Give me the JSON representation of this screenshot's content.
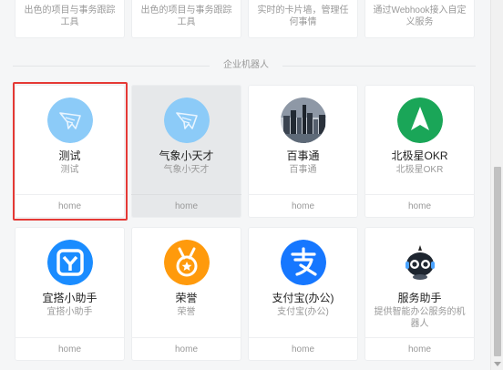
{
  "top_row": [
    {
      "desc": "出色的项目与事务跟踪工具"
    },
    {
      "desc": "出色的项目与事务跟踪工具"
    },
    {
      "desc": "实时的卡片墙，管理任何事情"
    },
    {
      "desc": "通过Webhook接入自定义服务"
    }
  ],
  "section": {
    "label": "企业机器人"
  },
  "robots": [
    {
      "title": "测试",
      "subtitle": "测试",
      "footer": "home",
      "icon": "robot-bird-icon",
      "selected": true,
      "disabled": false
    },
    {
      "title": "气象小天才",
      "subtitle": "气象小天才",
      "footer": "home",
      "icon": "robot-bird-icon",
      "selected": false,
      "disabled": true
    },
    {
      "title": "百事通",
      "subtitle": "百事通",
      "footer": "home",
      "icon": "city-skyline-icon",
      "selected": false,
      "disabled": false
    },
    {
      "title": "北极星OKR",
      "subtitle": "北极星OKR",
      "footer": "home",
      "icon": "north-star-icon",
      "selected": false,
      "disabled": false
    },
    {
      "title": "宜搭小助手",
      "subtitle": "宜搭小助手",
      "footer": "home",
      "icon": "yida-icon",
      "selected": false,
      "disabled": false
    },
    {
      "title": "荣誉",
      "subtitle": "荣誉",
      "footer": "home",
      "icon": "medal-icon",
      "selected": false,
      "disabled": false
    },
    {
      "title": "支付宝(办公)",
      "subtitle": "支付宝(办公)",
      "footer": "home",
      "icon": "alipay-icon",
      "selected": false,
      "disabled": false
    },
    {
      "title": "服务助手",
      "subtitle": "提供智能办公服务的机器人",
      "footer": "home",
      "icon": "service-robot-icon",
      "selected": false,
      "disabled": false
    }
  ],
  "colors": {
    "robot_blue": "#8ccbf8",
    "okr_green": "#1aa658",
    "yida_blue": "#1a8cff",
    "medal_orange": "#ff9a0c",
    "alipay_blue": "#1677ff",
    "selection_red": "#e53935"
  }
}
